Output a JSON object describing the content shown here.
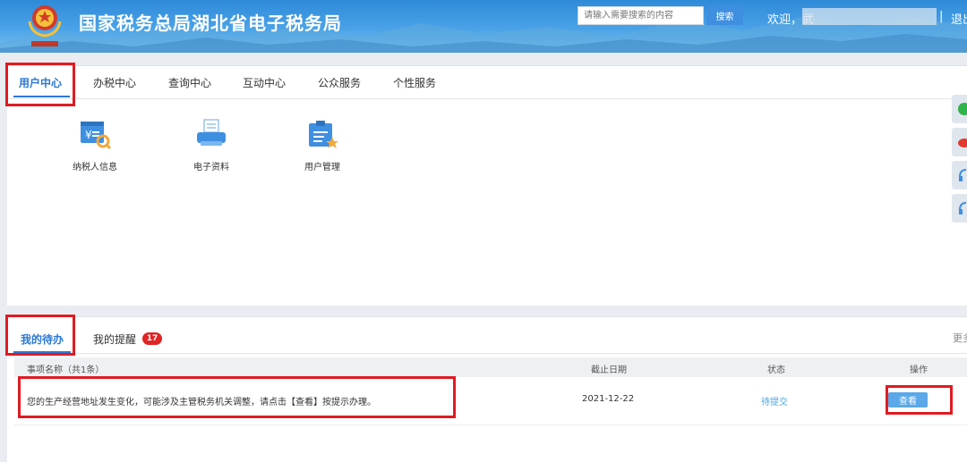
{
  "header": {
    "site_title": "国家税务总局湖北省电子税务局",
    "search_placeholder": "请输入需要搜索的内容",
    "search_button": "搜索",
    "welcome": "欢迎，武",
    "separator": "|",
    "logout": "退出"
  },
  "main_tabs": [
    {
      "label": "用户中心",
      "active": true
    },
    {
      "label": "办税中心",
      "active": false
    },
    {
      "label": "查询中心",
      "active": false
    },
    {
      "label": "互动中心",
      "active": false
    },
    {
      "label": "公众服务",
      "active": false
    },
    {
      "label": "个性服务",
      "active": false
    }
  ],
  "functions": [
    {
      "label": "纳税人信息",
      "icon": "taxpayer-info-icon"
    },
    {
      "label": "电子资料",
      "icon": "electronic-documents-icon"
    },
    {
      "label": "用户管理",
      "icon": "user-management-icon"
    }
  ],
  "todo": {
    "tabs": [
      {
        "label": "我的待办",
        "active": true
      },
      {
        "label": "我的提醒",
        "active": false
      }
    ],
    "reminder_count": "17",
    "more": "更多",
    "columns": [
      "事项名称（共1条）",
      "截止日期",
      "状态",
      "操作"
    ],
    "rows": [
      {
        "name": "您的生产经营地址发生变化，可能涉及主管税务机关调整，请点击【查看】按提示办理。",
        "deadline": "2021-12-22",
        "status": "待提交",
        "action": "查看"
      }
    ]
  },
  "colors": {
    "header_blue": "#2f8ad8",
    "accent": "#2a78d4",
    "highlight_box": "#e01b22",
    "badge": "#e02424"
  }
}
